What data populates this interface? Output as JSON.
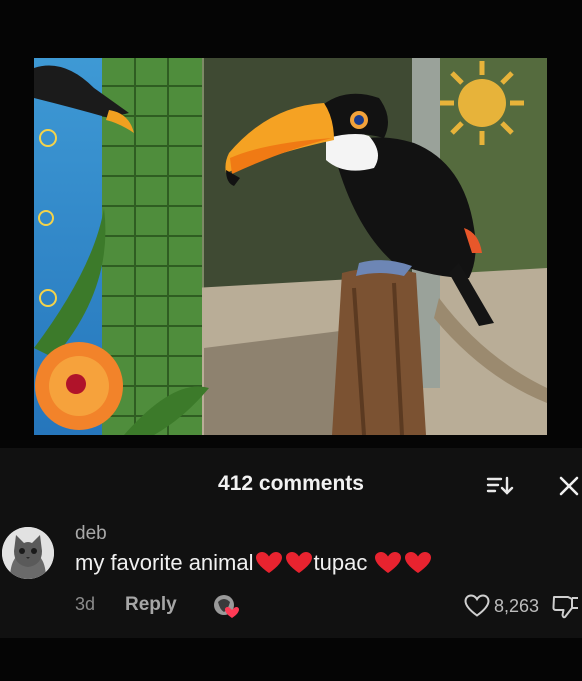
{
  "sheet": {
    "title": "412 comments"
  },
  "comment": {
    "username": "deb",
    "text_part1": "my favorite animal ",
    "text_part2": "tupac",
    "age": "3d",
    "reply_label": "Reply",
    "like_count": "8,263"
  },
  "icons": {
    "sort": "sort-icon",
    "close": "close-icon",
    "heart_emoji": "red-heart-emoji",
    "like": "heart-outline-icon",
    "dislike": "thumbs-down-icon",
    "creator_liked": "creator-liked-avatar"
  },
  "colors": {
    "background": "#050505",
    "sheet": "#111111",
    "heart": "#e8232f"
  }
}
